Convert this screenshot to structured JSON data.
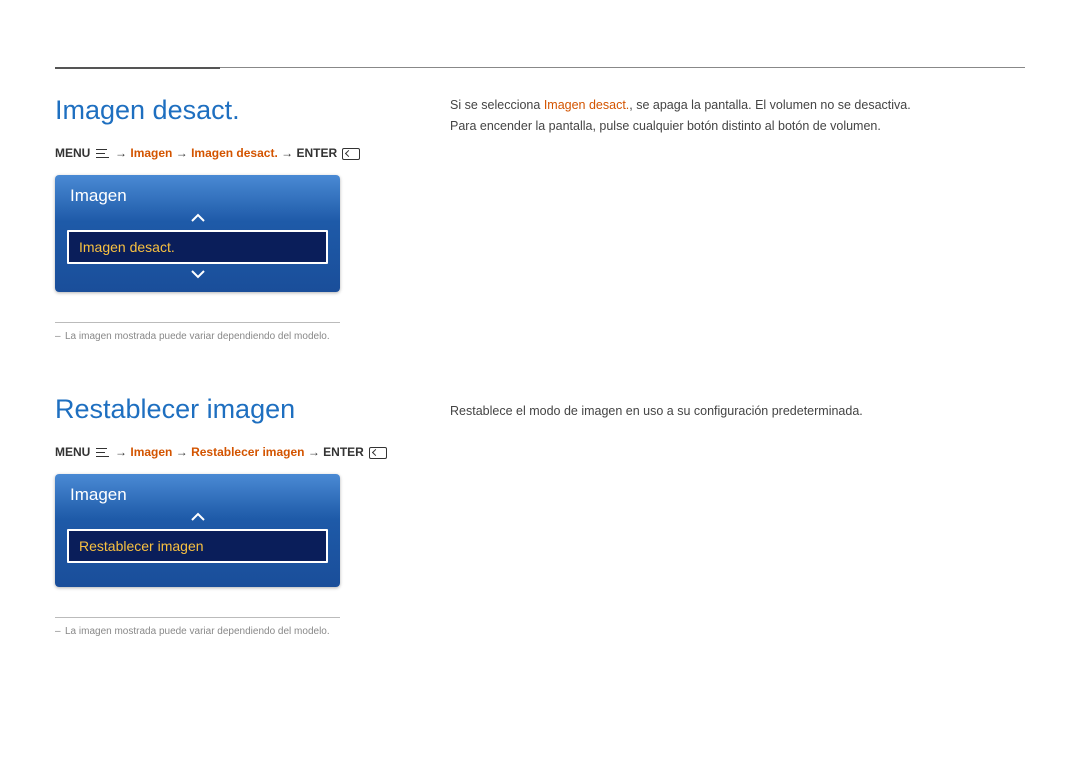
{
  "section1": {
    "title": "Imagen desact.",
    "breadcrumb": {
      "menu": "MENU",
      "path1": "Imagen",
      "path2": "Imagen desact.",
      "enter": "ENTER",
      "arrow": "→"
    },
    "panel": {
      "title": "Imagen",
      "item": "Imagen desact."
    },
    "note": "La imagen mostrada puede variar dependiendo del modelo.",
    "desc_line1_pre": "Si se selecciona ",
    "desc_line1_highlight": "Imagen desact.",
    "desc_line1_post": ", se apaga la pantalla. El volumen no se desactiva.",
    "desc_line2": "Para encender la pantalla, pulse cualquier botón distinto al botón de volumen."
  },
  "section2": {
    "title": "Restablecer imagen",
    "breadcrumb": {
      "menu": "MENU",
      "path1": "Imagen",
      "path2": "Restablecer imagen",
      "enter": "ENTER",
      "arrow": "→"
    },
    "panel": {
      "title": "Imagen",
      "item": "Restablecer imagen"
    },
    "note": "La imagen mostrada puede variar dependiendo del modelo.",
    "desc": "Restablece el modo de imagen en uso a su configuración predeterminada."
  }
}
